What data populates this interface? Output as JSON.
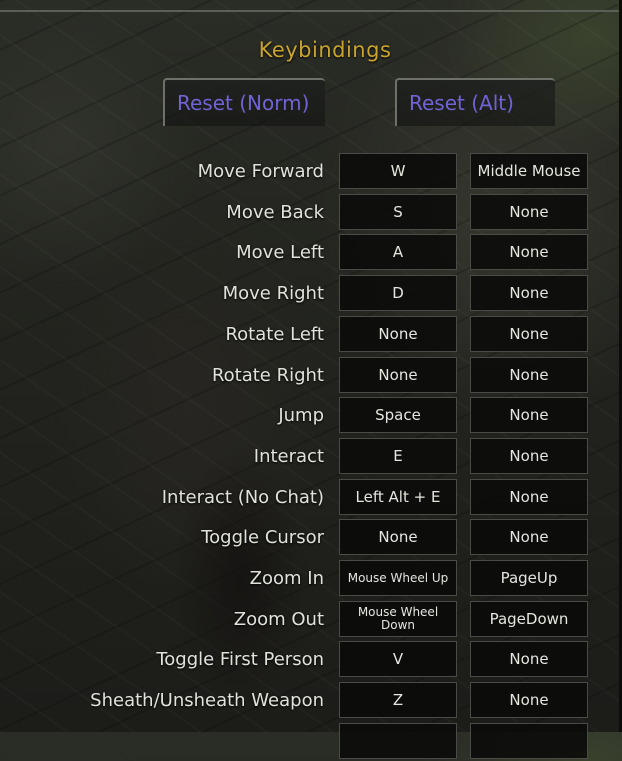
{
  "title": "Keybindings",
  "reset_norm_label": "Reset (Norm)",
  "reset_alt_label": "Reset (Alt)",
  "colors": {
    "title": "#c8a42e",
    "button_text": "#6f63d6",
    "text": "#e2e2dc"
  },
  "bindings": [
    {
      "action": "Move Forward",
      "primary": "W",
      "alt": "Middle Mouse"
    },
    {
      "action": "Move Back",
      "primary": "S",
      "alt": "None"
    },
    {
      "action": "Move Left",
      "primary": "A",
      "alt": "None"
    },
    {
      "action": "Move Right",
      "primary": "D",
      "alt": "None"
    },
    {
      "action": "Rotate Left",
      "primary": "None",
      "alt": "None"
    },
    {
      "action": "Rotate Right",
      "primary": "None",
      "alt": "None"
    },
    {
      "action": "Jump",
      "primary": "Space",
      "alt": "None"
    },
    {
      "action": "Interact",
      "primary": "E",
      "alt": "None"
    },
    {
      "action": "Interact (No Chat)",
      "primary": "Left Alt + E",
      "alt": "None"
    },
    {
      "action": "Toggle Cursor",
      "primary": "None",
      "alt": "None"
    },
    {
      "action": "Zoom In",
      "primary": "Mouse Wheel Up",
      "alt": "PageUp"
    },
    {
      "action": "Zoom Out",
      "primary": "Mouse Wheel Down",
      "alt": "PageDown"
    },
    {
      "action": "Toggle First Person",
      "primary": "V",
      "alt": "None"
    },
    {
      "action": "Sheath/Unsheath Weapon",
      "primary": "Z",
      "alt": "None"
    },
    {
      "action": "",
      "primary": "",
      "alt": ""
    }
  ]
}
